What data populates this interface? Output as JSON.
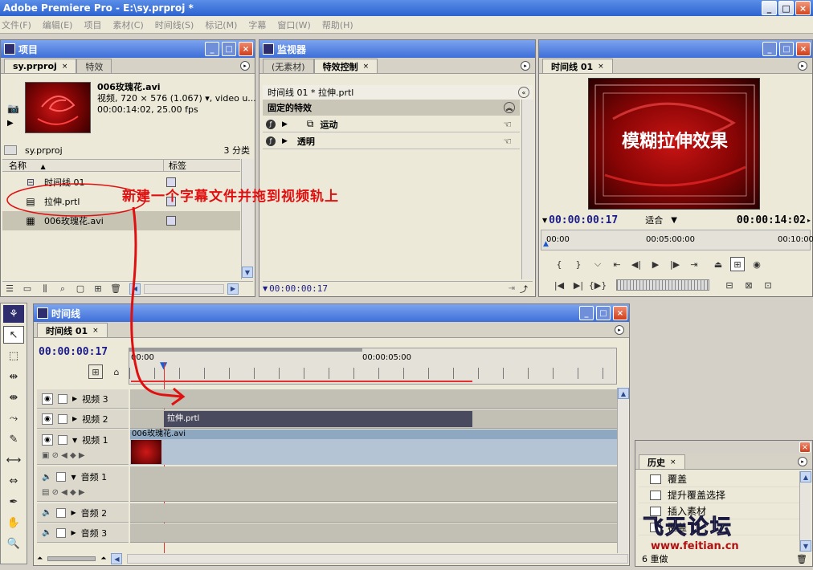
{
  "window": {
    "title": "Adobe Premiere Pro - E:\\sy.prproj *",
    "buttons": {
      "minimize": "_",
      "maximize": "□",
      "close": "×"
    }
  },
  "menu": [
    "文件(F)",
    "编辑(E)",
    "项目",
    "素材(C)",
    "时间线(S)",
    "标记(M)",
    "字幕",
    "窗口(W)",
    "帮助(H)"
  ],
  "project": {
    "panel_title": "项目",
    "tabs": [
      "sy.prproj",
      "特效"
    ],
    "clip": {
      "name": "006玫瑰花.avi",
      "info1": "视频, 720 × 576 (1.067)",
      "info1_tail": ", video u...",
      "info2": "00:00:14:02, 25.00 fps"
    },
    "bin_name": "sy.prproj",
    "item_count": "3 分类",
    "col_name": "名称",
    "col_label": "标签",
    "items": [
      "时间线 01",
      "拉伸.prtl",
      "006玫瑰花.avi"
    ]
  },
  "monitor": {
    "panel_title": "监视器",
    "tabs": [
      "(无素材)",
      "特效控制"
    ],
    "seq_label": "时间线 01 * 拉伸.prtl",
    "fixed_effects": "固定的特效",
    "effects": [
      "运动",
      "透明"
    ],
    "timecode": "00:00:00:17"
  },
  "program": {
    "tab": "时间线 01",
    "overlay_text": "模糊拉伸效果",
    "current_tc": "00:00:00:17",
    "fit": "适合",
    "duration_tc": "00:00:14:02",
    "ruler": [
      "00:00",
      "00:05:00:00",
      "00:10:00"
    ]
  },
  "timeline": {
    "panel_title": "时间线",
    "tab": "时间线 01",
    "current_tc": "00:00:00:17",
    "ruler": [
      "00:00",
      "00:00:05:00"
    ],
    "tracks": [
      {
        "name": "视频 3",
        "clip": ""
      },
      {
        "name": "视频 2",
        "clip": "拉伸.prtl"
      },
      {
        "name": "视频 1",
        "clip": "006玫瑰花.avi"
      },
      {
        "name": "音频 1",
        "clip": ""
      },
      {
        "name": "音频 2",
        "clip": ""
      },
      {
        "name": "音频 3",
        "clip": ""
      }
    ]
  },
  "history": {
    "tab": "历史",
    "items": [
      "覆盖",
      "提升覆盖选择",
      "插入素材",
      "覆盖"
    ],
    "footer": "6 重做"
  },
  "annotation": {
    "text": "新建一个字幕文件并拖到视频轨上",
    "color": "#e01010"
  },
  "watermark": {
    "brand": "飞天论坛",
    "url": "www.feitian.cn"
  },
  "colors": {
    "title_blue": "#3e6fd8",
    "timecode_blue": "#1c1c8c",
    "annotation_red": "#e01010",
    "playhead_red": "#e03030"
  }
}
